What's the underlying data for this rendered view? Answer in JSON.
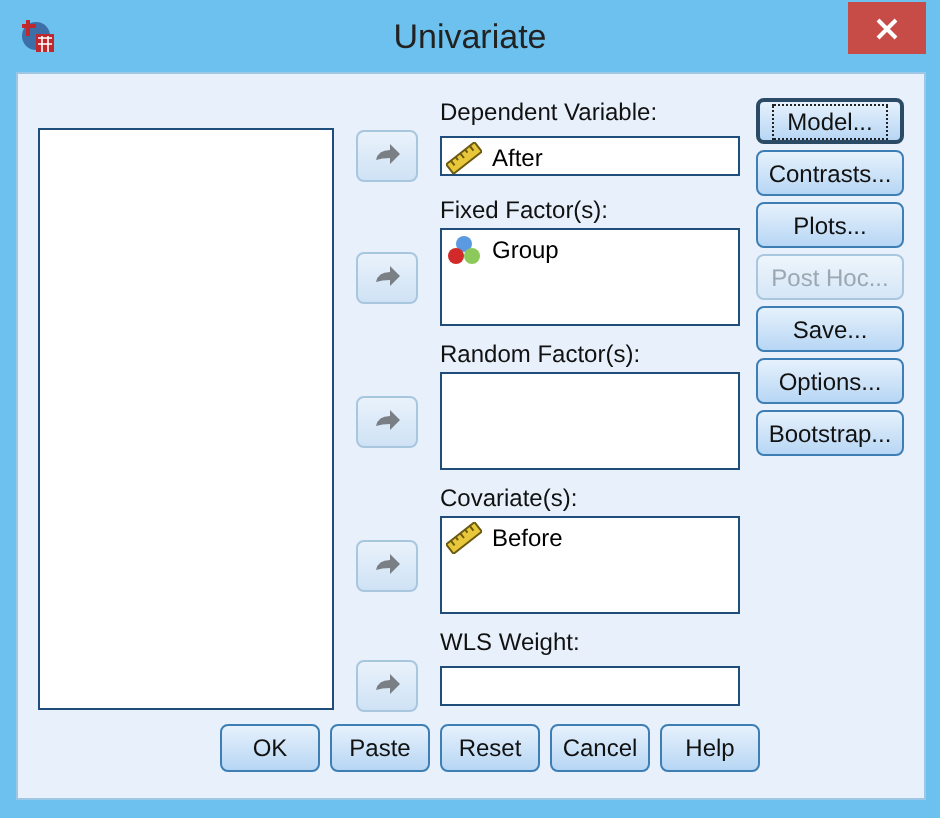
{
  "window": {
    "title": "Univariate"
  },
  "targets": [
    {
      "kind": "single",
      "label": "Dependent Variable:",
      "items": [
        {
          "name": "After",
          "kind": "scale"
        }
      ]
    },
    {
      "kind": "list",
      "label": "Fixed Factor(s):",
      "items": [
        {
          "name": "Group",
          "kind": "nominal"
        }
      ]
    },
    {
      "kind": "list",
      "label": "Random Factor(s):"
    },
    {
      "kind": "list",
      "label": "Covariate(s):",
      "items": [
        {
          "name": "Before",
          "kind": "scale"
        }
      ]
    },
    {
      "kind": "single",
      "label": "WLS Weight:"
    }
  ],
  "side_buttons": [
    {
      "label": "Model...",
      "focused": true,
      "disabled": false
    },
    {
      "label": "Contrasts...",
      "focused": false,
      "disabled": false
    },
    {
      "label": "Plots...",
      "focused": false,
      "disabled": false
    },
    {
      "label": "Post Hoc...",
      "focused": false,
      "disabled": true
    },
    {
      "label": "Save...",
      "focused": false,
      "disabled": false
    },
    {
      "label": "Options...",
      "focused": false,
      "disabled": false
    },
    {
      "label": "Bootstrap...",
      "focused": false,
      "disabled": false
    }
  ],
  "bottom_buttons": [
    "OK",
    "Paste",
    "Reset",
    "Cancel",
    "Help"
  ]
}
